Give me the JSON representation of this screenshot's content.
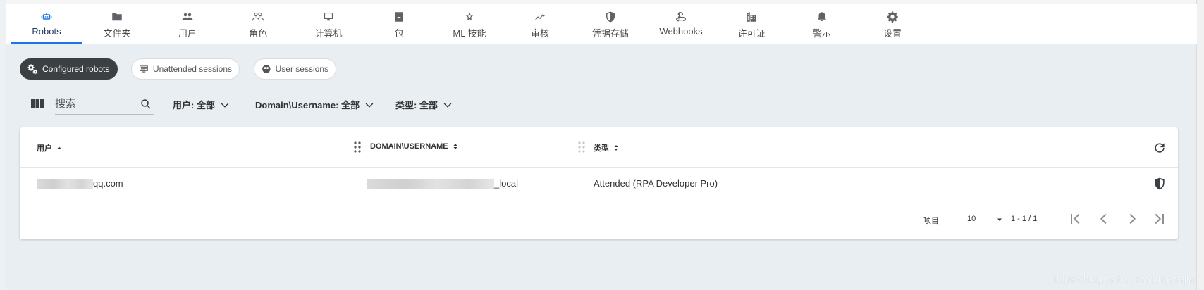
{
  "nav": {
    "items": [
      {
        "label": "Robots",
        "icon": "robot-icon",
        "active": true
      },
      {
        "label": "文件夹",
        "icon": "folder-icon"
      },
      {
        "label": "用户",
        "icon": "users-icon"
      },
      {
        "label": "角色",
        "icon": "roles-icon"
      },
      {
        "label": "计算机",
        "icon": "computer-icon"
      },
      {
        "label": "包",
        "icon": "package-icon"
      },
      {
        "label": "ML 技能",
        "icon": "ml-skill-icon"
      },
      {
        "label": "审核",
        "icon": "audit-icon"
      },
      {
        "label": "凭据存储",
        "icon": "credential-store-icon"
      },
      {
        "label": "Webhooks",
        "icon": "webhooks-icon"
      },
      {
        "label": "许可证",
        "icon": "license-icon"
      },
      {
        "label": "警示",
        "icon": "bell-icon"
      },
      {
        "label": "设置",
        "icon": "gear-icon"
      }
    ]
  },
  "chips": {
    "configured": "Configured robots",
    "unattended": "Unattended sessions",
    "user_sessions": "User sessions"
  },
  "filters": {
    "search_placeholder": "搜索",
    "user": "用户: 全部",
    "domain": "Domain\\Username: 全部",
    "type": "类型: 全部"
  },
  "table": {
    "columns": {
      "user": "用户",
      "domain": "DOMAIN\\USERNAME",
      "type": "类型"
    },
    "rows": [
      {
        "user_suffix": "qq.com",
        "domain_suffix": "_local",
        "type": "Attended (RPA Developer Pro)"
      }
    ]
  },
  "pagination": {
    "items_label": "项目",
    "page_size": "10",
    "range": "1 - 1 / 1"
  },
  "watermark": "https://blog.csdn.net/compassjia",
  "colors": {
    "accent": "#1a73e8",
    "chip_active": "#3c4043",
    "background": "#e8eef2"
  }
}
